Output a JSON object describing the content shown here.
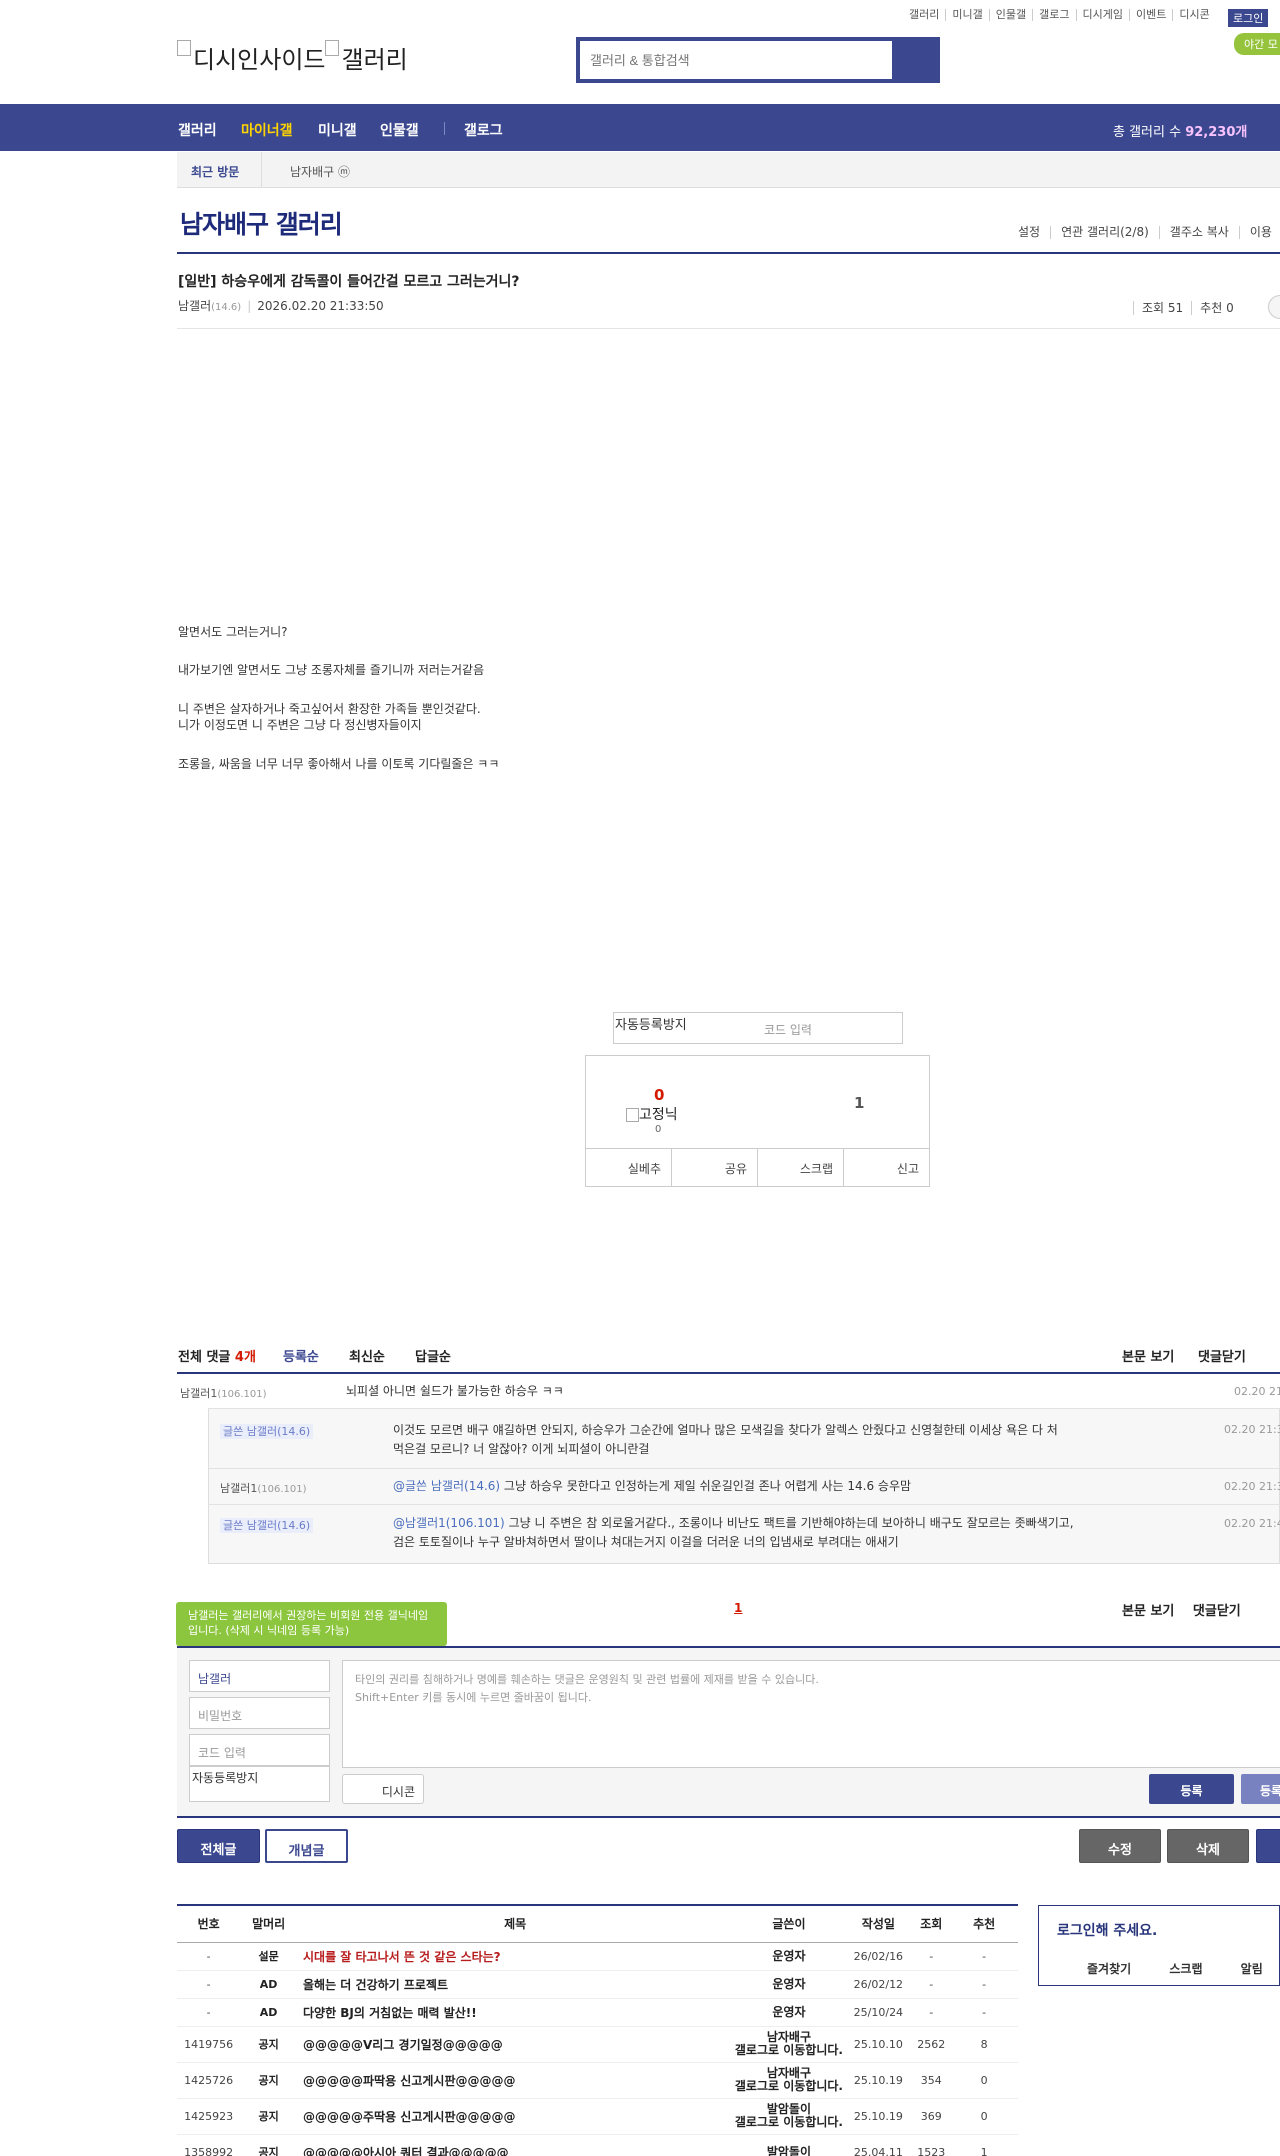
{
  "top_links": [
    "갤러리",
    "미니갤",
    "인물갤",
    "갤로그",
    "디시게임",
    "이벤트",
    "디시콘"
  ],
  "login": "로그인",
  "night_mode": "야간 모",
  "logo": {
    "left": "디시인사이드",
    "right": "갤러리"
  },
  "search": {
    "placeholder": "갤러리 & 통합검색"
  },
  "nav": {
    "items": [
      "갤러리",
      "마이너갤",
      "미니갤",
      "인물갤",
      "갤로그"
    ],
    "total_label": "총 갤러리 수",
    "total_value": "92,230개"
  },
  "recent": {
    "label": "최근 방문",
    "gallery": "남자배구 ⓜ"
  },
  "gallery": {
    "title": "남자배구 갤러리",
    "tools": [
      "설정",
      "연관 갤러리(2/8)",
      "갤주소 복사",
      "이용"
    ]
  },
  "post": {
    "title": "[일반] 하승우에게 감독콜이 들어간걸 모르고 그러는거니?",
    "author": "남갤러",
    "author_ip": "(14.6)",
    "date": "2026.02.20 21:33:50",
    "views": "조회 51",
    "recommend": "추천 0",
    "body": [
      "알면서도 그러는거니?",
      "내가보기엔 알면서도 그냥 조롱자체를 즐기니까 저러는거같음",
      "니 주변은 살자하거나  죽고싶어서 환장한 가족들 뿐인것같다.",
      "니가 이정도면 니 주변은 그냥 다 정신병자들이지",
      "조롱을, 싸움을 너무 너무 좋아해서  나를 이토록 기다릴줄은  ㅋㅋ"
    ]
  },
  "captcha": {
    "alt": "자동등록방지",
    "placeholder": "코드 입력"
  },
  "recommend_box": {
    "up": "0",
    "fixed_label": "고정닉",
    "fixed_count": "0",
    "down": "1",
    "buttons": [
      "실베추",
      "공유",
      "스크랩",
      "신고"
    ]
  },
  "comments": {
    "total_label": "전체 댓글",
    "count": "4개",
    "sorts": [
      "등록순",
      "최신순",
      "답글순"
    ],
    "view_body": "본문 보기",
    "close": "댓글닫기",
    "items": [
      {
        "nick": "남갤러1",
        "ip": "(106.101)",
        "text": "뇌피셜 아니면 쉴드가 불가능한 하승우 ㅋㅋ",
        "date": "02.20 21:"
      },
      {
        "nick": "글쓴 남갤러",
        "ip": "(14.6)",
        "text1": "이것도 모르면 배구 얘길하면 안되지, 하승우가 그순간에 얼마나 많은 모색길을 찾다가 알렉스 안줬다고 신영철한테 이세상 욕은 다 처",
        "text2": "먹은걸 모르니? 너 알잖아? 이게 뇌피셜이 아니란걸",
        "date": "02.20 21:3"
      },
      {
        "nick": "남갤러1",
        "ip": "(106.101)",
        "at": "@글쓴 남갤러(14.6)",
        "text": " 그냥 하승우 못한다고 인정하는게 제일 쉬운길인걸 존나 어렵게 사는 14.6 승우맘",
        "date": "02.20 21:3"
      },
      {
        "nick": "글쓴 남갤러",
        "ip": "(14.6)",
        "at": "@남갤러1(106.101)",
        "text1": " 그냥 니 주변은 참 외로울거같다., 조롱이나 비난도 팩트를 기반해야하는데 보아하니 배구도 잘모르는 좃빠색기고,",
        "text2": "검은 토토질이나 누구 알바쳐하면서 딸이나 쳐대는거지 이걸을 더러운 너의 입냄새로 부려대는 애새기",
        "date": "02.20 21:4"
      }
    ],
    "page": "1"
  },
  "write": {
    "tooltip": "남갤러는 갤러리에서 권장하는 비회원 전용 갤닉네임입니다. (삭제 시 닉네임 등록 가능)",
    "nick": "남갤러",
    "password": "비밀번호",
    "code": "코드 입력",
    "captcha_alt": "자동등록방지",
    "placeholder1": "타인의 권리를 침해하거나 명예를 훼손하는 댓글은 운영원칙 및 관련 법률에 제재를 받을 수 있습니다.",
    "placeholder2": "Shift+Enter 키를 동시에 누르면 줄바꿈이 됩니다.",
    "dccon": "디시콘",
    "submit": "등록",
    "submit2": "등록"
  },
  "actions": {
    "all": "전체글",
    "concept": "개념글",
    "edit": "수정",
    "delete": "삭제"
  },
  "list": {
    "headers": [
      "번호",
      "말머리",
      "제목",
      "글쓴이",
      "작성일",
      "조회",
      "추천"
    ],
    "rows": [
      {
        "no": "-",
        "head": "설문",
        "subject": "시대를 잘 타고나서 뜬 것 같은 스타는?",
        "writer": "운영자",
        "date": "26/02/16",
        "views": "-",
        "rec": "-",
        "red": true
      },
      {
        "no": "-",
        "head": "AD",
        "subject": "올해는 더 건강하기 프로젝트",
        "writer": "운영자",
        "date": "26/02/12",
        "views": "-",
        "rec": "-"
      },
      {
        "no": "-",
        "head": "AD",
        "subject": "다양한 BJ의 거침없는 매력 발산!!",
        "writer": "운영자",
        "date": "25/10/24",
        "views": "-",
        "rec": "-"
      },
      {
        "no": "1419756",
        "head": "공지",
        "subject": "@@@@@V리그 경기일정@@@@@",
        "writer": "남자배구",
        "writer2": "갤로그로 이동합니다.",
        "date": "25.10.10",
        "views": "2562",
        "rec": "8"
      },
      {
        "no": "1425726",
        "head": "공지",
        "subject": "@@@@@파딱용 신고게시판@@@@@",
        "writer": "남자배구",
        "writer2": "갤로그로 이동합니다.",
        "date": "25.10.19",
        "views": "354",
        "rec": "0"
      },
      {
        "no": "1425923",
        "head": "공지",
        "subject": "@@@@@주딱용 신고게시판@@@@@",
        "writer": "발암돌이",
        "writer2": "갤로그로 이동합니다.",
        "date": "25.10.19",
        "views": "369",
        "rec": "0"
      },
      {
        "no": "1358992",
        "head": "공지",
        "subject": "@@@@@아시아 쿼터 결과@@@@@",
        "writer": "발암돌이",
        "writer2": "",
        "date": "25.04.11",
        "views": "1523",
        "rec": "1"
      }
    ]
  },
  "login_box": {
    "title": "로그인해 주세요.",
    "links": [
      "즐겨찾기",
      "스크랩",
      "알림"
    ]
  }
}
